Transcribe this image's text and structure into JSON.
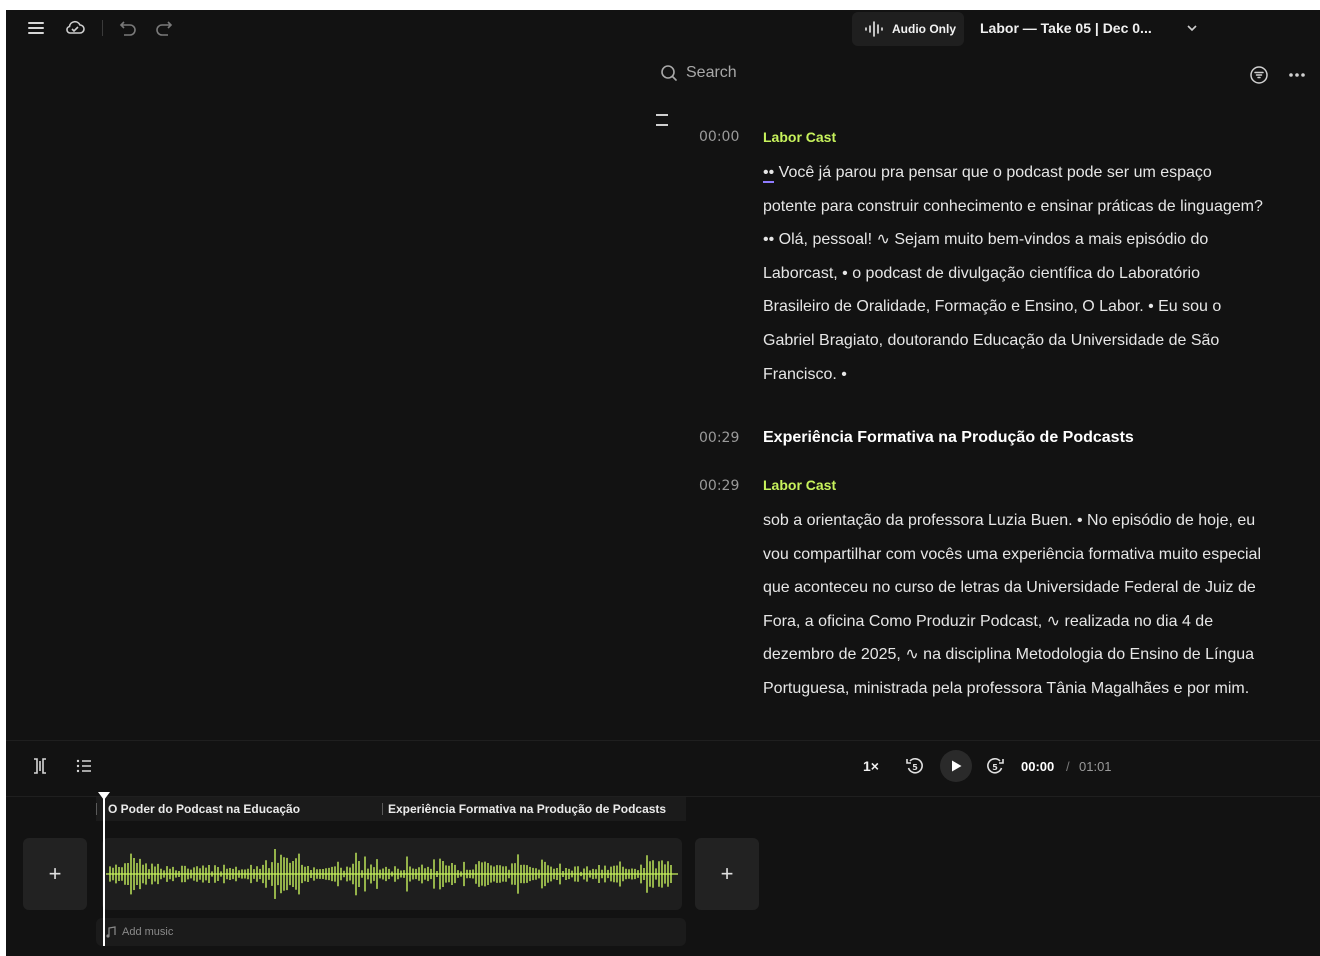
{
  "topbar": {
    "audio_only_label": "Audio Only",
    "document_title": "Labor — Take 05 | Dec 0..."
  },
  "search": {
    "label": "Search"
  },
  "transcript": {
    "block1": {
      "timestamp": "00:00",
      "speaker": "Labor Cast",
      "text_start": "••",
      "text_rest": " Você já parou pra pensar que o podcast pode ser um espaço potente para construir conhecimento e ensinar práticas de linguagem? •• Olá, pessoal! ∿ Sejam muito bem-vindos a mais episódio do Laborcast, • o podcast de divulgação científica do Laboratório Brasileiro de Oralidade, Formação e Ensino, O Labor. • Eu sou o Gabriel Bragiato, doutorando Educação da Universidade de São Francisco. •"
    },
    "chapter": {
      "timestamp": "00:29",
      "title": "Experiência Formativa na Produção de Podcasts"
    },
    "block2": {
      "timestamp": "00:29",
      "speaker": "Labor Cast",
      "text": "sob a orientação da professora Luzia Buen. • No episódio de hoje, eu vou compartilhar com vocês uma experiência formativa muito especial que aconteceu no curso de letras da Universidade Federal de Juiz de Fora, a oficina Como Produzir Podcast, ∿ realizada no dia 4 de dezembro de 2025, ∿ na disciplina Metodologia do Ensino de Língua Portuguesa, ministrada pela professora Tânia Magalhães e por mim."
    }
  },
  "player": {
    "speed": "1×",
    "rewind_seconds": "5",
    "forward_seconds": "5",
    "current_time": "00:00",
    "separator": "/",
    "total_time": "01:01"
  },
  "timeline": {
    "chapters": [
      "O Poder do Podcast na Educação",
      "Experiência Formativa na Produção de Podcasts"
    ],
    "add_music_label": "Add music",
    "add_label": "+",
    "waveform_color": "#c7f25c"
  },
  "colors": {
    "accent": "#c7f25c",
    "background": "#121212",
    "highlight_underline": "#8f7bff"
  }
}
